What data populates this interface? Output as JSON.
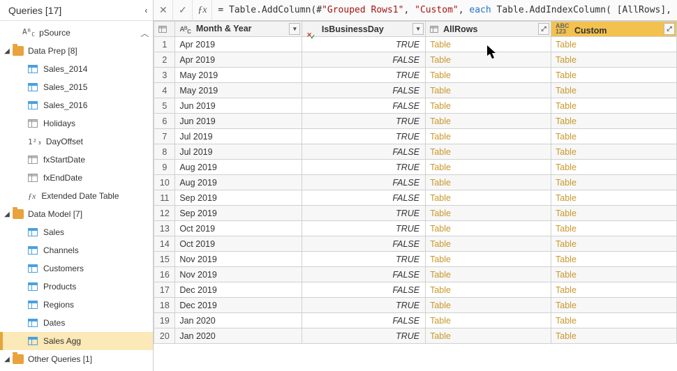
{
  "queries": {
    "header": "Queries [17]",
    "pSource": {
      "type": "abc",
      "label": "pSource"
    },
    "groups": [
      {
        "name": "Data Prep [8]",
        "items": [
          {
            "icon": "table",
            "label": "Sales_2014"
          },
          {
            "icon": "table",
            "label": "Sales_2015"
          },
          {
            "icon": "table",
            "label": "Sales_2016"
          },
          {
            "icon": "table-grey",
            "label": "Holidays"
          },
          {
            "icon": "num",
            "label": "DayOffset"
          },
          {
            "icon": "table-grey",
            "label": "fxStartDate"
          },
          {
            "icon": "table-grey",
            "label": "fxEndDate"
          },
          {
            "icon": "fx",
            "label": "Extended Date Table"
          }
        ]
      },
      {
        "name": "Data Model [7]",
        "items": [
          {
            "icon": "table",
            "label": "Sales"
          },
          {
            "icon": "table",
            "label": "Channels"
          },
          {
            "icon": "table",
            "label": "Customers"
          },
          {
            "icon": "table",
            "label": "Products"
          },
          {
            "icon": "table",
            "label": "Regions"
          },
          {
            "icon": "table",
            "label": "Dates"
          },
          {
            "icon": "table",
            "label": "Sales Agg",
            "selected": true
          }
        ]
      },
      {
        "name": "Other Queries [1]",
        "items": []
      }
    ]
  },
  "formula": {
    "prefix": "= Table.AddColumn(#",
    "lit1": "\"Grouped Rows1\"",
    "sep1": ", ",
    "lit2": "\"Custom\"",
    "sep2": ", ",
    "kw": "each",
    "rest": " Table.AddIndexColumn( [AllRows],"
  },
  "columns": {
    "monthYear": "Month & Year",
    "isBiz": "IsBusinessDay",
    "allRows": "AllRows",
    "custom": "Custom"
  },
  "rows": [
    {
      "n": 1,
      "my": "Apr 2019",
      "biz": "TRUE",
      "ar": "Table",
      "cu": "Table"
    },
    {
      "n": 2,
      "my": "Apr 2019",
      "biz": "FALSE",
      "ar": "Table",
      "cu": "Table"
    },
    {
      "n": 3,
      "my": "May 2019",
      "biz": "TRUE",
      "ar": "Table",
      "cu": "Table"
    },
    {
      "n": 4,
      "my": "May 2019",
      "biz": "FALSE",
      "ar": "Table",
      "cu": "Table"
    },
    {
      "n": 5,
      "my": "Jun 2019",
      "biz": "FALSE",
      "ar": "Table",
      "cu": "Table"
    },
    {
      "n": 6,
      "my": "Jun 2019",
      "biz": "TRUE",
      "ar": "Table",
      "cu": "Table"
    },
    {
      "n": 7,
      "my": "Jul 2019",
      "biz": "TRUE",
      "ar": "Table",
      "cu": "Table"
    },
    {
      "n": 8,
      "my": "Jul 2019",
      "biz": "FALSE",
      "ar": "Table",
      "cu": "Table"
    },
    {
      "n": 9,
      "my": "Aug 2019",
      "biz": "TRUE",
      "ar": "Table",
      "cu": "Table"
    },
    {
      "n": 10,
      "my": "Aug 2019",
      "biz": "FALSE",
      "ar": "Table",
      "cu": "Table"
    },
    {
      "n": 11,
      "my": "Sep 2019",
      "biz": "FALSE",
      "ar": "Table",
      "cu": "Table"
    },
    {
      "n": 12,
      "my": "Sep 2019",
      "biz": "TRUE",
      "ar": "Table",
      "cu": "Table"
    },
    {
      "n": 13,
      "my": "Oct 2019",
      "biz": "TRUE",
      "ar": "Table",
      "cu": "Table"
    },
    {
      "n": 14,
      "my": "Oct 2019",
      "biz": "FALSE",
      "ar": "Table",
      "cu": "Table"
    },
    {
      "n": 15,
      "my": "Nov 2019",
      "biz": "TRUE",
      "ar": "Table",
      "cu": "Table"
    },
    {
      "n": 16,
      "my": "Nov 2019",
      "biz": "FALSE",
      "ar": "Table",
      "cu": "Table"
    },
    {
      "n": 17,
      "my": "Dec 2019",
      "biz": "FALSE",
      "ar": "Table",
      "cu": "Table"
    },
    {
      "n": 18,
      "my": "Dec 2019",
      "biz": "TRUE",
      "ar": "Table",
      "cu": "Table"
    },
    {
      "n": 19,
      "my": "Jan 2020",
      "biz": "FALSE",
      "ar": "Table",
      "cu": "Table"
    },
    {
      "n": 20,
      "my": "Jan 2020",
      "biz": "TRUE",
      "ar": "Table",
      "cu": "Table"
    }
  ],
  "icons": {
    "abc": "AᴮC",
    "num": "1²₃",
    "abc123": "ABC\n123"
  }
}
